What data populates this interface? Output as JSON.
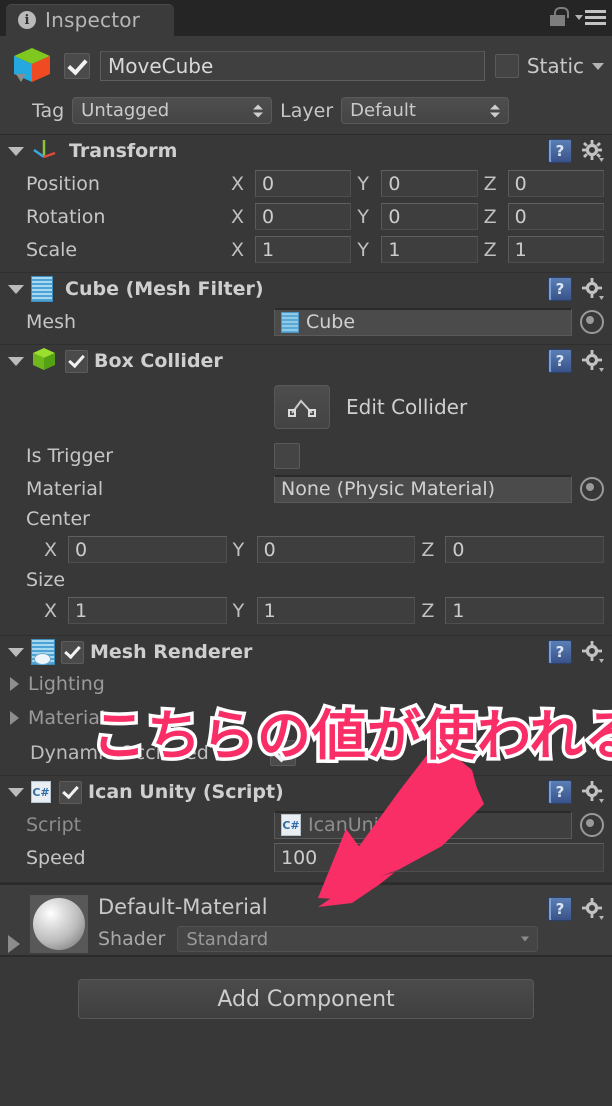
{
  "window": {
    "tab_label": "Inspector",
    "tab_icon": "info-icon",
    "lock_icon": "lock-open-icon",
    "menu_icon": "hamburger-menu-icon"
  },
  "object_header": {
    "icon": "cube-gameobject-icon",
    "enabled": true,
    "name": "MoveCube",
    "static_label": "Static",
    "tag_label": "Tag",
    "tag_value": "Untagged",
    "layer_label": "Layer",
    "layer_value": "Default"
  },
  "components": [
    {
      "id": "transform",
      "title": "Transform",
      "icon": "transform-axis-icon",
      "rows": [
        {
          "label": "Position",
          "x": "0",
          "y": "0",
          "z": "0"
        },
        {
          "label": "Rotation",
          "x": "0",
          "y": "0",
          "z": "0"
        },
        {
          "label": "Scale",
          "x": "1",
          "y": "1",
          "z": "1"
        }
      ]
    },
    {
      "id": "mesh-filter",
      "title": "Cube (Mesh Filter)",
      "icon": "mesh-filter-icon",
      "mesh_label": "Mesh",
      "mesh_value": "Cube"
    },
    {
      "id": "box-collider",
      "title": "Box Collider",
      "icon": "box-collider-icon",
      "enabled": true,
      "edit_collider_label": "Edit Collider",
      "is_trigger_label": "Is Trigger",
      "is_trigger_value": false,
      "material_label": "Material",
      "material_value": "None (Physic Material)",
      "center_label": "Center",
      "center": {
        "x": "0",
        "y": "0",
        "z": "0"
      },
      "size_label": "Size",
      "size": {
        "x": "1",
        "y": "1",
        "z": "1"
      }
    },
    {
      "id": "mesh-renderer",
      "title": "Mesh Renderer",
      "icon": "mesh-renderer-icon",
      "enabled": true,
      "lighting_label": "Lighting",
      "materials_label": "Materials",
      "dynamic_occluded_label": "Dynamic Occluded",
      "dynamic_occluded_value": true
    },
    {
      "id": "ican-unity-script",
      "title": "Ican Unity (Script)",
      "icon": "csharp-script-icon",
      "enabled": true,
      "script_label": "Script",
      "script_value": "IcanUnity",
      "speed_label": "Speed",
      "speed_value": "100"
    }
  ],
  "axis_labels": {
    "x": "X",
    "y": "Y",
    "z": "Z"
  },
  "material_block": {
    "name": "Default-Material",
    "shader_label": "Shader",
    "shader_value": "Standard",
    "preview_icon": "material-sphere-preview"
  },
  "footer": {
    "add_component_label": "Add Component"
  },
  "annotation": {
    "text": "こちらの値が使われる",
    "color": "#fa2e66",
    "outline_color": "#ffffff",
    "arrow": "pink-arrow-pointing-to-speed-field"
  },
  "icons": {
    "help": "help-book-icon",
    "settings": "gear-icon",
    "object_picker": "object-picker-icon"
  }
}
